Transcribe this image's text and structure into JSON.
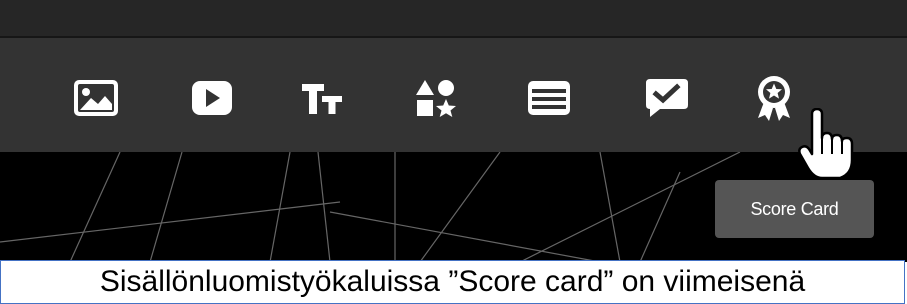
{
  "toolbar": {
    "tools": [
      {
        "icon": "image-icon",
        "tooltip": ""
      },
      {
        "icon": "video-play-icon",
        "tooltip": ""
      },
      {
        "icon": "text-icon",
        "tooltip": ""
      },
      {
        "icon": "shapes-icon",
        "tooltip": ""
      },
      {
        "icon": "table-icon",
        "tooltip": ""
      },
      {
        "icon": "quiz-checkbox-icon",
        "tooltip": ""
      },
      {
        "icon": "score-card-icon",
        "tooltip": "Score Card"
      }
    ]
  },
  "tooltip": {
    "text": "Score Card"
  },
  "caption": {
    "text": "Sisällönluomistyökaluissa ”Score card” on viimeisenä"
  },
  "colors": {
    "toolbar_bg": "#333333",
    "topbar_bg": "#262626",
    "canvas_bg": "#000000",
    "icon": "#ffffff",
    "tooltip_bg": "#555555",
    "caption_border": "#4472c4"
  }
}
